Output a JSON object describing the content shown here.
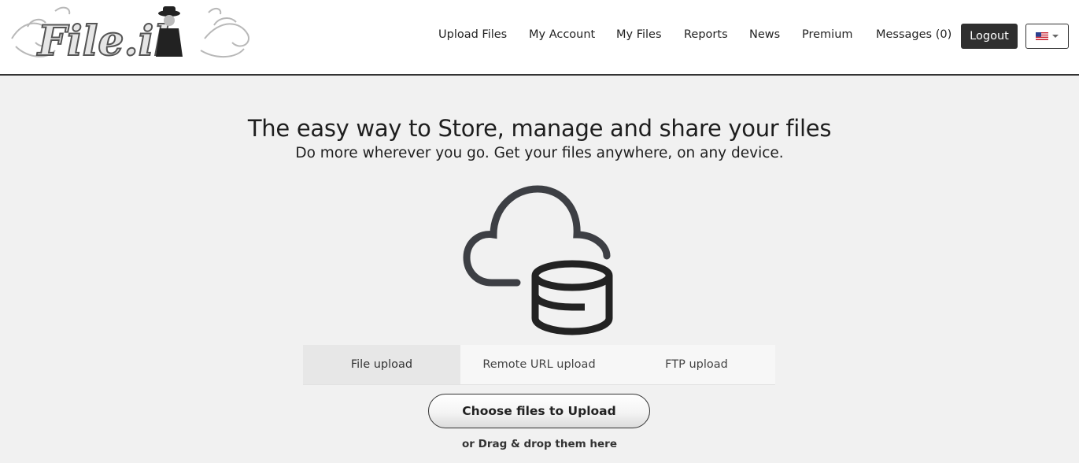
{
  "brand": {
    "logo_text": "File.il"
  },
  "nav": {
    "items": [
      {
        "label": "Upload Files"
      },
      {
        "label": "My Account"
      },
      {
        "label": "My Files"
      },
      {
        "label": "Reports"
      },
      {
        "label": "News"
      },
      {
        "label": "Premium"
      },
      {
        "label": "Messages (0)"
      }
    ],
    "logout_label": "Logout",
    "language_icon": "us-flag-icon"
  },
  "hero": {
    "title": "The easy way to Store, manage and share your files",
    "subtitle": "Do more wherever you go. Get your files anywhere, on any device."
  },
  "upload": {
    "icon": "cloud-storage-icon",
    "tabs": [
      {
        "label": "File upload",
        "active": true
      },
      {
        "label": "Remote URL upload",
        "active": false
      },
      {
        "label": "FTP upload",
        "active": false
      }
    ],
    "choose_button_label": "Choose files to Upload",
    "drag_text": "or Drag & drop them here"
  },
  "colors": {
    "header_bg": "#ffffff",
    "page_bg": "#f1f1f1",
    "logout_bg": "#2f2f2f",
    "icon_stroke": "#3d3f44"
  }
}
